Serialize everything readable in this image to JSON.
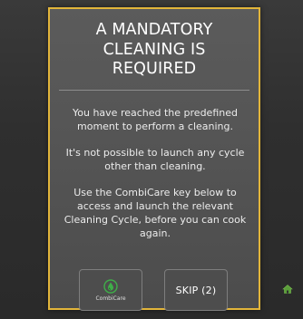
{
  "dialog": {
    "title_lines": [
      "A MANDATORY",
      "CLEANING IS",
      "REQUIRED"
    ],
    "message_1_lines": [
      "You have reached the predefined",
      "moment to perform a cleaning."
    ],
    "message_2_lines": [
      "It's not possible to launch any cycle",
      "other than cleaning."
    ],
    "message_3_lines": [
      "Use the CombiCare key below to",
      "access and launch the relevant",
      "Cleaning Cycle, before you can cook",
      "again."
    ]
  },
  "buttons": {
    "combicare_label": "CombiCare",
    "combicare_icon": "combicare-drop-icon",
    "skip_label": "SKIP (2)"
  },
  "footer": {
    "home_icon": "home-icon"
  },
  "colors": {
    "frame_accent": "#e2b53a",
    "combicare_green": "#3fae49",
    "home_green": "#5a9e3a"
  }
}
